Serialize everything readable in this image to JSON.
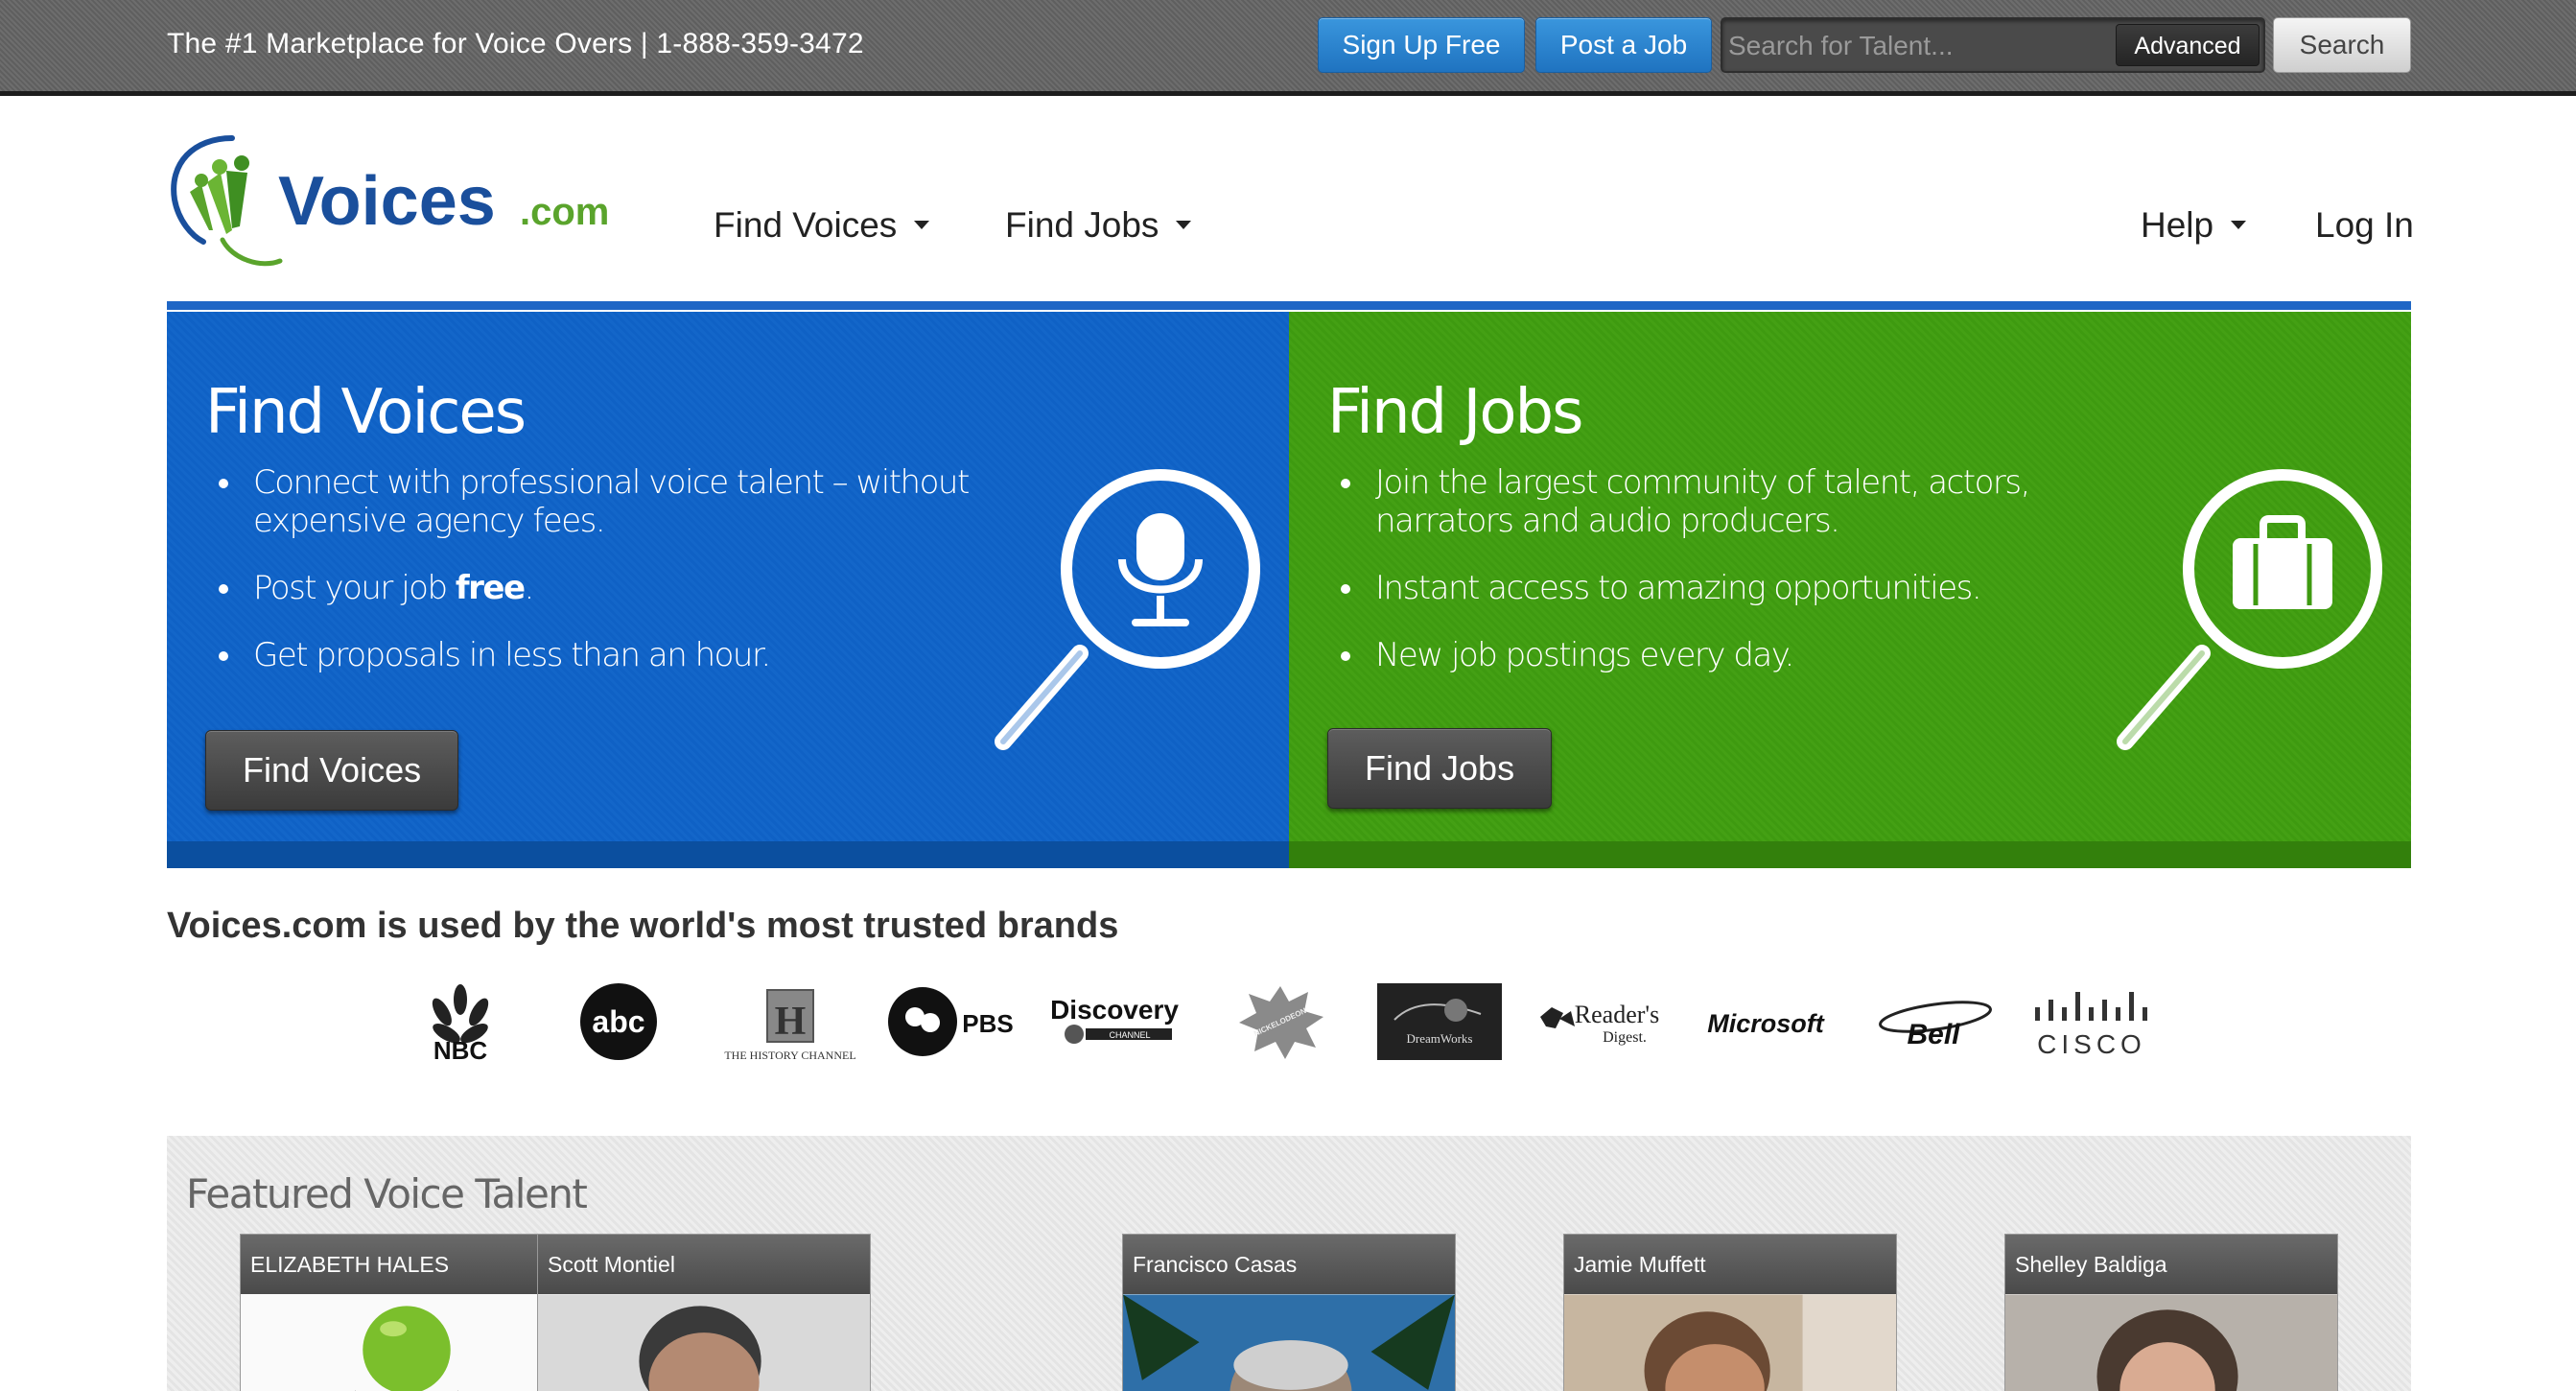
{
  "topbar": {
    "tagline": "The #1 Marketplace for Voice Overs | 1-888-359-3472",
    "signup_label": "Sign Up Free",
    "postjob_label": "Post a Job",
    "search_placeholder": "Search for Talent...",
    "advanced_label": "Advanced",
    "search_label": "Search"
  },
  "header": {
    "logo_main": "Voices",
    "logo_suffix": ".com",
    "nav": {
      "find_voices": "Find Voices",
      "find_jobs": "Find Jobs",
      "help": "Help",
      "login": "Log In"
    }
  },
  "hero": {
    "voices": {
      "title": "Find Voices",
      "bullet1": "Connect with professional voice talent – without expensive agency fees.",
      "bullet2_prefix": "Post your job ",
      "bullet2_bold": "free",
      "bullet2_suffix": ".",
      "bullet3": "Get proposals in less than an hour.",
      "button": "Find Voices"
    },
    "jobs": {
      "title": "Find Jobs",
      "bullet1": "Join the largest community of talent, actors, narrators and audio producers.",
      "bullet2": "Instant access to amazing opportunities.",
      "bullet3": "New job postings every day.",
      "button": "Find Jobs"
    }
  },
  "brands": {
    "title": "Voices.com is used by the world's most trusted brands",
    "nbc": "NBC",
    "abc": "abc",
    "history_letter": "H",
    "history": "THE HISTORY CHANNEL",
    "pbs": "PBS",
    "discovery": "Discovery",
    "discovery_sub": "CHANNEL",
    "nickelodeon": "NICKELODEON",
    "dreamworks": "DreamWorks",
    "readers_digest_1": "Reader's",
    "readers_digest_2": "Digest.",
    "microsoft": "Microsoft",
    "bell": "Bell",
    "cisco": "CISCO"
  },
  "featured": {
    "title": "Featured Voice Talent",
    "talent": [
      {
        "name": "ELIZABETH HALES"
      },
      {
        "name": "Scott Montiel"
      },
      {
        "name": "Francisco Casas"
      },
      {
        "name": "Jamie Muffett"
      },
      {
        "name": "Shelley Baldiga"
      }
    ]
  },
  "colors": {
    "blue_panel": "#1366c9",
    "green_panel": "#44a014",
    "nav_rule": "#1f66c5",
    "button_blue": "#2a85d0"
  }
}
